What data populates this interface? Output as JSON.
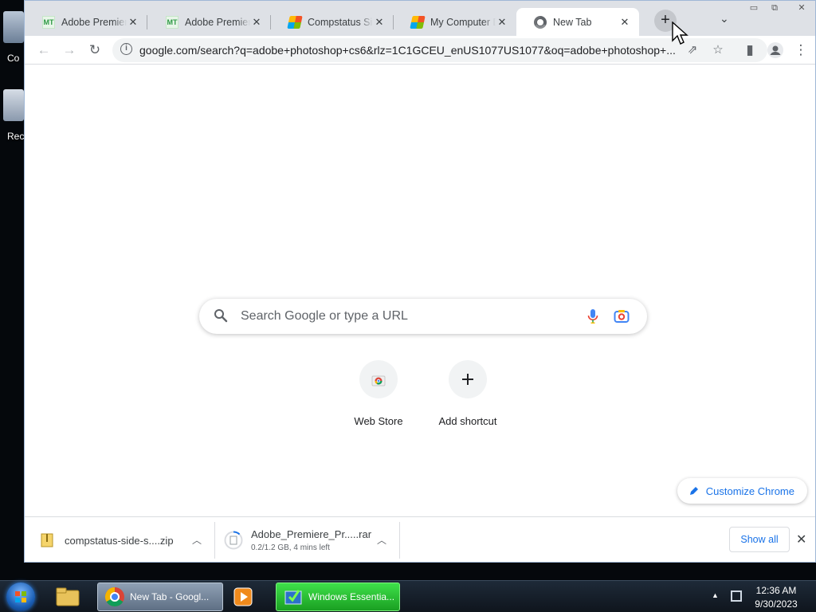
{
  "desktop": {
    "icons": [
      {
        "label": "Co"
      },
      {
        "label": "Rec"
      }
    ]
  },
  "browser": {
    "tabs": [
      {
        "title": "Adobe Premiere",
        "favicon": "mt-icon",
        "active": false
      },
      {
        "title": "Adobe Premiere",
        "favicon": "mt-icon",
        "active": false
      },
      {
        "title": "Compstatus Side",
        "favicon": "windows-flag-icon",
        "active": false
      },
      {
        "title": "My Computer Da",
        "favicon": "windows-flag-icon",
        "active": false
      },
      {
        "title": "New Tab",
        "favicon": "chrome-icon",
        "active": true
      }
    ],
    "new_tab_label": "+",
    "tab_close_glyph": "✕",
    "url": "google.com/search?q=adobe+photoshop+cs6&rlz=1C1GCEU_enUS1077US1077&oq=adobe+photoshop+...",
    "search_placeholder": "Search Google or type a URL",
    "shortcuts": [
      {
        "label": "Web Store",
        "icon": "web-store-icon"
      },
      {
        "label": "Add shortcut",
        "icon": "plus-icon"
      }
    ],
    "customize_label": "Customize Chrome"
  },
  "downloads": {
    "items": [
      {
        "name": "compstatus-side-s....zip",
        "status": ""
      },
      {
        "name": "Adobe_Premiere_Pr.....rar",
        "status": "0.2/1.2 GB, 4 mins left"
      }
    ],
    "show_all_label": "Show all"
  },
  "taskbar": {
    "buttons": [
      {
        "label": "New Tab - Googl...",
        "icon": "chrome-icon"
      },
      {
        "label": "Windows Essentia...",
        "icon": "windows-essentials-icon"
      }
    ],
    "clock": {
      "time": "12:36 AM",
      "date": "9/30/2023"
    }
  },
  "colors": {
    "accent": "#1a73e8",
    "tabstrip": "#dee1e6",
    "taskbar": "#0f151d",
    "essentials_green": "#2fc33a"
  }
}
